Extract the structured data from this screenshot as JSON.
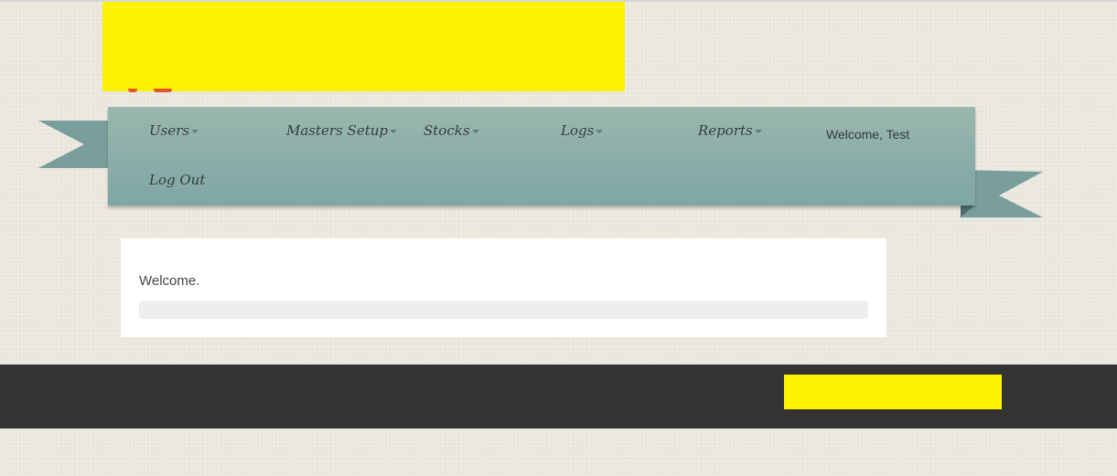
{
  "colors": {
    "redaction": "#fff200",
    "ribbon": "#8eaea8",
    "footer": "#333333",
    "panel": "#ffffff"
  },
  "nav": {
    "items": [
      {
        "label": "Users",
        "has_dropdown": true
      },
      {
        "label": "Masters Setup",
        "has_dropdown": true
      },
      {
        "label": "Stocks",
        "has_dropdown": true
      },
      {
        "label": "Logs",
        "has_dropdown": true
      },
      {
        "label": "Reports",
        "has_dropdown": true
      }
    ],
    "welcome": "Welcome, Test",
    "logout": "Log Out"
  },
  "main": {
    "welcome_text": "Welcome."
  }
}
